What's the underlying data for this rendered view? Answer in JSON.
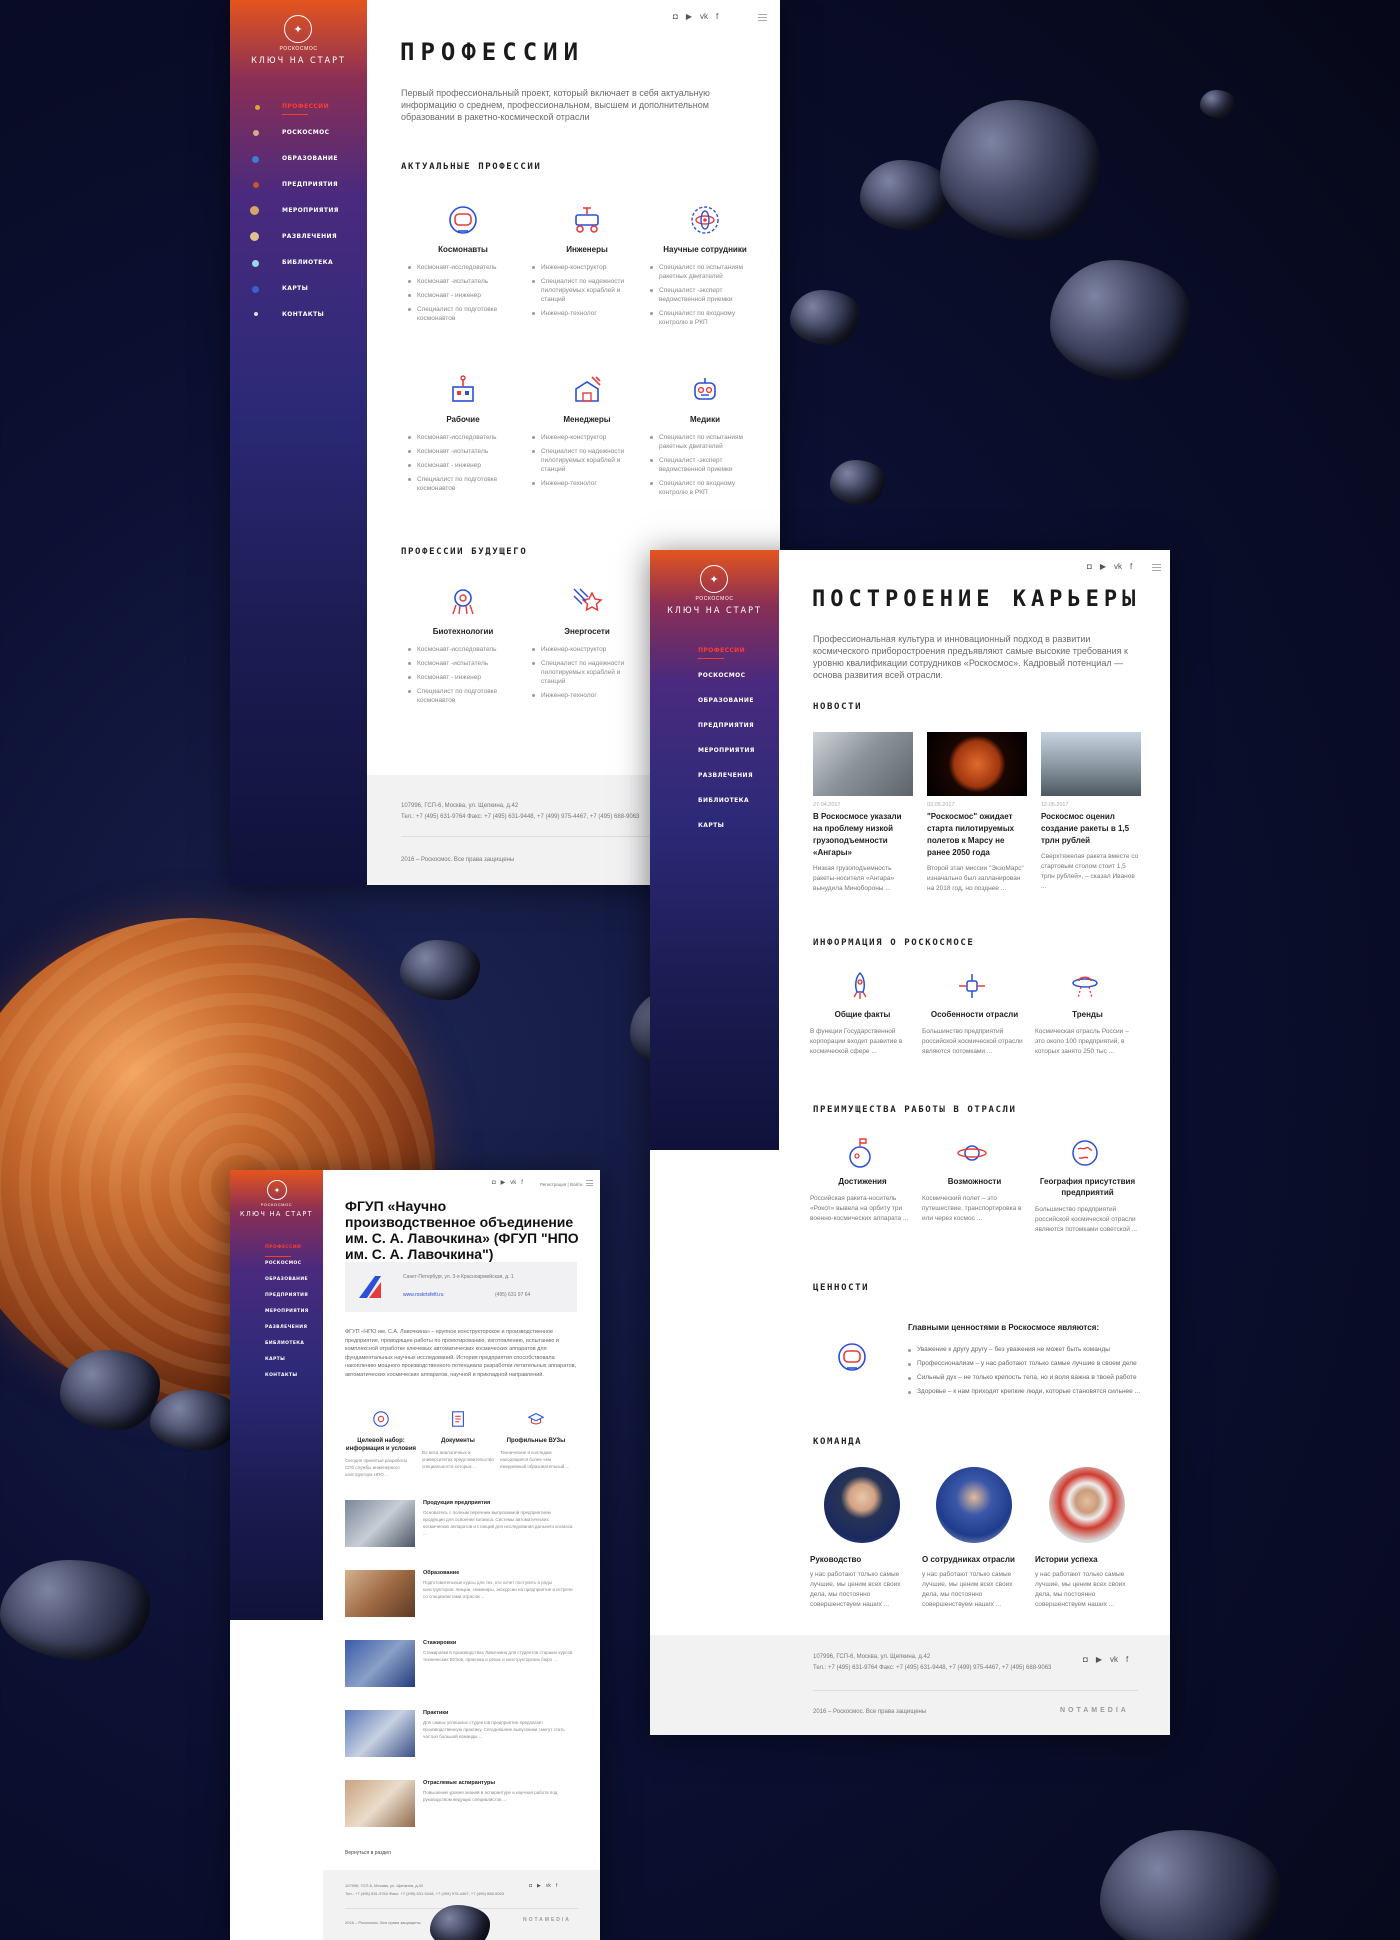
{
  "brand": {
    "logo_text": "РОСКОСМОС",
    "sidebar_title": "Ключ на старт"
  },
  "nav": [
    "Профессии",
    "Роскосмос",
    "Образование",
    "Предприятия",
    "Мероприятия",
    "Развлечения",
    "Библиотека",
    "Карты",
    "Контакты"
  ],
  "professions": {
    "title": "Профессии",
    "lead": "Первый профессиональный проект, который включает в себя актуальную информацию о среднем, профессиональном, высшем и дополнительном образовании в ракетно-космической отрасли",
    "current_title": "Актуальные профессии",
    "current": [
      {
        "name": "Космонавты",
        "icon": "astronaut-helmet-icon",
        "items": [
          "Космонавт-исследователь",
          "Космонавт -испытатель",
          "Космонавт - инженер",
          "Специалист по подготовке космонавтов"
        ]
      },
      {
        "name": "Инженеры",
        "icon": "lunar-rover-icon",
        "items": [
          "Инженер-конструктор",
          "Специалист по надежности пилотируемых кораблей и станций",
          "Инженер-технолог"
        ]
      },
      {
        "name": "Научные сотрудники",
        "icon": "atom-icon",
        "items": [
          "Специалист по испытаниям ракетных двигателей",
          "Специалист -эксперт ведомственной приемки",
          "Специалист по входному контролю в РКП"
        ]
      },
      {
        "name": "Рабочие",
        "icon": "factory-icon",
        "items": [
          "Космонавт-исследователь",
          "Космонавт -испытатель",
          "Космонавт - инженер",
          "Специалист по подготовке космонавтов"
        ]
      },
      {
        "name": "Менеджеры",
        "icon": "station-icon",
        "items": [
          "Инженер-конструктор",
          "Специалист по надежности пилотируемых кораблей и станций",
          "Инженер-технолог"
        ]
      },
      {
        "name": "Медики",
        "icon": "robot-icon",
        "items": [
          "Специалист по испытаниям ракетных двигателей",
          "Специалист -эксперт ведомственной приемки",
          "Специалист по входному контролю в РКП"
        ]
      }
    ],
    "future_title": "Профессии будущего",
    "future": [
      {
        "name": "Биотехнологии",
        "icon": "alien-icon",
        "items": [
          "Космонавт-исследователь",
          "Космонавт -испытатель",
          "Космонавт - инженер",
          "Специалист по подготовке космонавтов"
        ]
      },
      {
        "name": "Энергосети",
        "icon": "comet-icon",
        "items": [
          "Инженер-конструктор",
          "Специалист по надежности пилотируемых кораблей и станций",
          "Инженер-технолог"
        ]
      }
    ]
  },
  "footer": {
    "address": "107996, ГСП-6, Москва, ул. Щепкина, д.42",
    "phones": "Тел.: +7 (495) 631-9764  Факс: +7 (495) 631-9448, +7 (499) 975-4467, +7 (495) 688-9063",
    "copyright": "2016 – Роскосмос. Все права защищены",
    "maker": "NOTAMEDIA"
  },
  "career": {
    "title": "Построение карьеры",
    "lead": "Профессиональная культура и инновационный подход в развитии космического приборостроения предъявляют самые высокие требования к уровню квалификации сотрудников «Роскосмос». Кадровый потенциал — основа развития всей отрасли.",
    "news_title": "Новости",
    "news": [
      {
        "date": "27.04.2017",
        "title": "В Роскосмосе указали на проблему низкой грузоподъемности «Ангары»",
        "text": "Низкая грузоподъемность ракеты-носителя «Ангара» вынудила Минобороны ..."
      },
      {
        "date": "03.05.2017",
        "title": "\"Роскосмос\" ожидает старта пилотируемых полетов к Марсу не ранее 2050 года",
        "text": "Второй этап миссии \"ЭкзоМарс\" изначально был запланирован на 2018 год, но позднее ..."
      },
      {
        "date": "12.05.2017",
        "title": "Роскосмос оценил создание ракеты в 1,5 трлн рублей",
        "text": "Сверхтяжелая ракета вместе со стартовым столом стоит 1,5 трлн рублей», – сказал Иванов ..."
      }
    ],
    "info_title": "Информация о Роскосмосе",
    "info": [
      {
        "title": "Общие факты",
        "icon": "rocket-icon",
        "text": "В функции Государственной корпорации входит развитие в космической сфере ..."
      },
      {
        "title": "Особенности отрасли",
        "icon": "satellite-icon",
        "text": "Большинство предприятий российской космической отрасли являются потомками ..."
      },
      {
        "title": "Тренды",
        "icon": "ufo-icon",
        "text": "Космическая отрасль России – это около 100 предприятий, в которых занято 250 тыс ..."
      }
    ],
    "adv_title": "Преимущества работы в отрасли",
    "adv": [
      {
        "title": "Достижения",
        "icon": "moon-flag-icon",
        "text": "Российская ракета-носитель «Рокот» вывела на орбиту три военно-космических аппарата ..."
      },
      {
        "title": "Возможности",
        "icon": "planet-ring-icon",
        "text": "Космический полет – это путешествие, транспортировка в или через космос ..."
      },
      {
        "title": "География присутствия предприятий",
        "icon": "globe-icon",
        "text": "Большинство предприятий российской космической отрасли являются потомками советской ..."
      }
    ],
    "values_title": "Ценности",
    "values_heading": "Главными ценностями в Роскосмосе являются:",
    "values": [
      "Уважение к другу другу – без уважения не может быть команды",
      "Профессионализм – у нас работают только самые лучшие в своем деле",
      "Сильный дух – не только крепость тела, но и воля важна в твоей работе",
      "Здоровье – к нам приходят крепкие люди, которые становятся сильнее ..."
    ],
    "team_title": "Команда",
    "team": [
      {
        "title": "Руководство",
        "text": "у нас работают только самые лучшие, мы ценим всех своих дела, мы постоянно совершенствуем наших ..."
      },
      {
        "title": "О сотрудниках отрасли",
        "text": "у нас работают только самые лучшие, мы ценим всех своих дела, мы постоянно совершенствуем наших ..."
      },
      {
        "title": "Истории успеха",
        "text": "у нас работают только самые лучшие, мы ценим всех своих дела, мы постоянно совершенствуем наших ..."
      }
    ]
  },
  "org": {
    "login": "Регистрация | Войти",
    "title": "ФГУП «Научно производственное объединение им. С. А. Лавочкина» (ФГУП \"НПО им. С. А. Лавочкина\")",
    "address": "Санкт-Петербург, ул. 3-я Красноармейская, д. 1",
    "site": "www.roskrtsfelti.ru",
    "phone": "(495) 631 97 64",
    "about": "ФГУП «НПО им. С.А. Лавочкина» – крупное конструкторское и производственное предприятие, проводящее работы по проектированию, изготовлению, испытанию и комплексной отработке ключевых автоматических космических аппаратов для фундаментальных научных исследований. История предприятия способствовала накоплению мощного производственного потенциала разработки летательных аппаратов, автоматических космических аппаратов, научной и прикладной направлений.",
    "mini": [
      {
        "title": "Целевой набор: информация и условия",
        "text": "Сегодня принятые разработы СПб службы инженерного конструктора НПО ..."
      },
      {
        "title": "Документы",
        "text": "Во веса аналогичных и университетах представительство специальности которых ..."
      },
      {
        "title": "Профильные ВУЗы",
        "text": "Технические и колледжи находящиеся более чем ежедневный образовательный ..."
      }
    ],
    "list": [
      {
        "title": "Продукция предприятия",
        "text": "Основатель с полным перечнем выпускаемой предприятием продукции для освоения космоса. Системы автоматических космических аппаратов и станций для исследования дальнего космоса ..."
      },
      {
        "title": "Образование",
        "text": "Подготовительные курсы для тех, кто хочет поступить в ряды конструкторов: лекции, семинары, экскурсии на предприятие и встречи со специалистами отрасли ..."
      },
      {
        "title": "Стажировки",
        "text": "Стажировки в производствах Лавочкина для студентов старших курсов технических ВУЗов, практика в цехах и конструкторских бюро ..."
      },
      {
        "title": "Практики",
        "text": "Для самых успешных студентов предприятие предлагает производственную практику. Сегодняшние выпускники смогут стать частью большой команды ..."
      },
      {
        "title": "Отраслевые аспирантуры",
        "text": "Повышение уровня знаний в аспирантуре и научная работа под руководством ведущих специалистов ..."
      }
    ],
    "back": "Вернуться в раздел",
    "copyright": "2016 – Роскосмос. Все права защищены"
  }
}
